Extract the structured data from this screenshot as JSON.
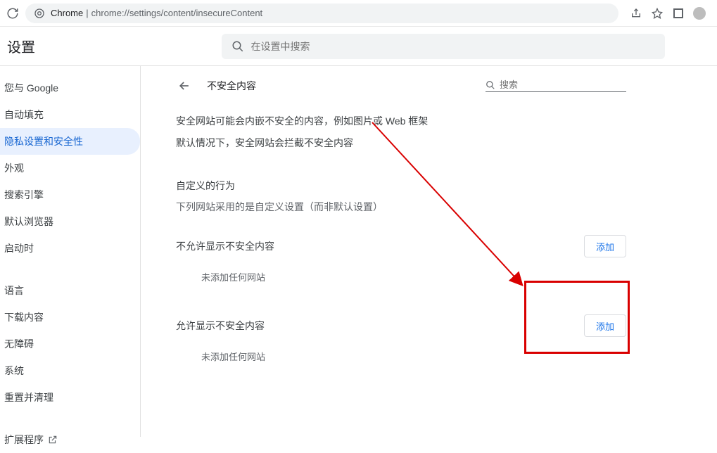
{
  "toolbar": {
    "url_prefix": "Chrome",
    "url_separator": " | ",
    "url_path": "chrome://settings/content/insecureContent"
  },
  "header": {
    "title": "设置",
    "search_placeholder": "在设置中搜索"
  },
  "sidebar": {
    "items": [
      {
        "label": "您与 Google"
      },
      {
        "label": "自动填充"
      },
      {
        "label": "隐私设置和安全性",
        "active": true
      },
      {
        "label": "外观"
      },
      {
        "label": "搜索引擎"
      },
      {
        "label": "默认浏览器"
      },
      {
        "label": "启动时"
      }
    ],
    "items2": [
      {
        "label": "语言"
      },
      {
        "label": "下载内容"
      },
      {
        "label": "无障碍"
      },
      {
        "label": "系统"
      },
      {
        "label": "重置并清理"
      }
    ],
    "extension": "扩展程序"
  },
  "content": {
    "title": "不安全内容",
    "search_placeholder": "搜索",
    "desc1": "安全网站可能会内嵌不安全的内容，例如图片或 Web 框架",
    "desc2": "默认情况下，安全网站会拦截不安全内容",
    "custom_title": "自定义的行为",
    "custom_sub": "下列网站采用的是自定义设置（而非默认设置）",
    "block_label": "不允许显示不安全内容",
    "block_empty": "未添加任何网站",
    "allow_label": "允许显示不安全内容",
    "allow_empty": "未添加任何网站",
    "add_button": "添加"
  }
}
